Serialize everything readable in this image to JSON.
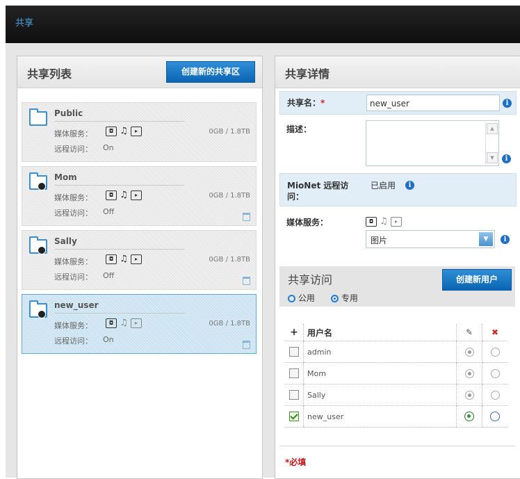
{
  "topbar": {
    "title": "共享"
  },
  "left": {
    "title": "共享列表",
    "create_button": "创建新的共享区",
    "media_label": "媒体服务：",
    "remote_label": "远程访问：",
    "items": [
      {
        "name": "Public",
        "remote": "On",
        "size": "0GB / 1.8TB"
      },
      {
        "name": "Mom",
        "remote": "Off",
        "size": "0GB / 1.8TB"
      },
      {
        "name": "Sally",
        "remote": "Off",
        "size": "0GB / 1.8TB"
      },
      {
        "name": "new_user",
        "remote": "On",
        "size": "0GB / 1.8TB"
      }
    ]
  },
  "right": {
    "title": "共享详情",
    "share_name_label": "共享名：",
    "share_name_required": "*",
    "share_name_value": "new_user",
    "desc_label": "描述：",
    "desc_value": "",
    "mionet_label_1": "MioNet 远程访",
    "mionet_label_2": "问：",
    "mionet_value": "已启用",
    "media_label": "媒体服务：",
    "media_select_value": "图片",
    "access_title": "共享访问",
    "create_user_button": "创建新用户",
    "public_label": "公用",
    "private_label": "专用",
    "table": {
      "add_symbol": "+",
      "username_header": "用户名",
      "rows": [
        {
          "name": "admin",
          "checked": false,
          "write": true
        },
        {
          "name": "Mom",
          "checked": false,
          "write": true
        },
        {
          "name": "Sally",
          "checked": false,
          "write": true
        },
        {
          "name": "new_user",
          "checked": true,
          "write": true
        }
      ]
    },
    "required_note": "*必填"
  },
  "colors": {
    "accent": "#1f6fc4",
    "required": "#c21818",
    "selected_bg": "#c9e2f1"
  },
  "icons": [
    "folder-icon",
    "lock-icon",
    "photo-icon",
    "music-icon",
    "video-icon",
    "trash-icon",
    "info-icon",
    "pencil-icon",
    "delete-x-icon"
  ]
}
